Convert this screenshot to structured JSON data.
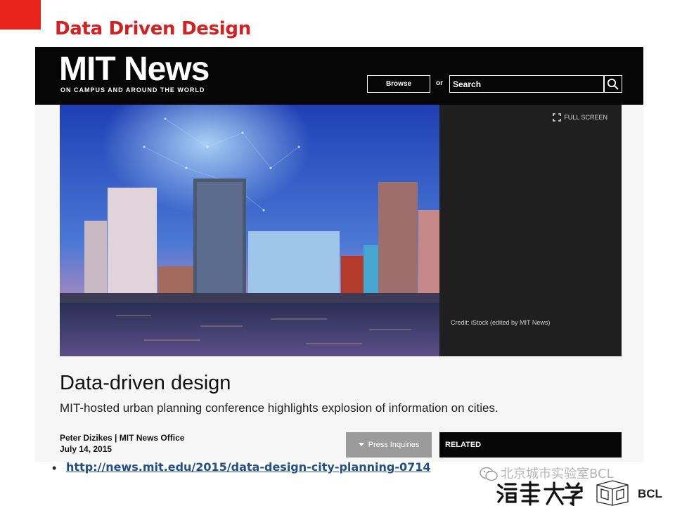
{
  "slide": {
    "title": "Data Driven Design",
    "link_url": "http://news.mit.edu/2015/data-design-city-planning-0714",
    "watermark": "北京城市实验室BCL",
    "bcl_label": "BCL",
    "accent_color": "#e8231a"
  },
  "mit_header": {
    "logo": "MIT News",
    "tagline": "ON CAMPUS AND AROUND THE WORLD",
    "browse_label": "Browse",
    "or_label": "or",
    "search_value": "Search",
    "search_icon": "search-icon"
  },
  "media": {
    "fullscreen_label": "FULL SCREEN",
    "credit": "Credit: iStock (edited by MIT News)"
  },
  "article": {
    "title": "Data-driven design",
    "subtitle": "MIT-hosted urban planning conference highlights explosion of information on cities.",
    "byline": "Peter Dizikes | MIT News Office",
    "date": "July 14, 2015",
    "press_label": "Press Inquiries",
    "related_label": "RELATED"
  }
}
